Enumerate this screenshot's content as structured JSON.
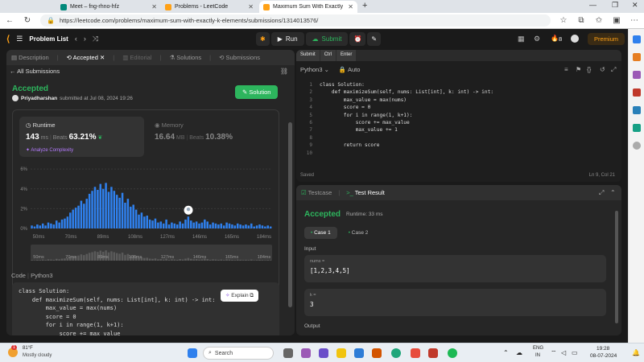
{
  "browser": {
    "tabs": [
      {
        "title": "Meet – fng-rhno-hfz",
        "color": "#00897b",
        "active": false
      },
      {
        "title": "Problems - LeetCode",
        "color": "#ffa116",
        "active": false
      },
      {
        "title": "Maximum Sum With Exactly K Elements",
        "color": "#ffa116",
        "active": true
      }
    ],
    "url": "https://leetcode.com/problems/maximum-sum-with-exactly-k-elements/submissions/1314013576/"
  },
  "nav": {
    "problem_list": "Problem List",
    "run": "Run",
    "submit": "Submit",
    "streak": "8",
    "premium": "Premium"
  },
  "left": {
    "tabs": [
      "Description",
      "Accepted",
      "Editorial",
      "Solutions",
      "Submissions"
    ],
    "all_submissions": "All Submissions",
    "status": "Accepted",
    "author": "Priyadharshan",
    "submitted": "submitted at Jul 08, 2024 19:26",
    "solution_btn": "Solution",
    "runtime": {
      "label": "Runtime",
      "value": "143",
      "unit": "ms",
      "beats_label": "Beats",
      "beats": "63.21%"
    },
    "memory": {
      "label": "Memory",
      "value": "16.64",
      "unit": "MB",
      "beats_label": "Beats",
      "beats": "10.38%"
    },
    "analyze": "Analyze Complexity",
    "code_label": "Code",
    "code_lang": "Python3",
    "explain": "Explain",
    "code_lines": [
      "class Solution:",
      "    def maximizeSum(self, nums: List[int], k: int) -> int:",
      "        max_value = max(nums)",
      "        score = 0",
      "        for i in range(1, k+1):",
      "            score += max_value"
    ]
  },
  "chart_data": {
    "type": "bar",
    "ylabels": [
      "6%",
      "4%",
      "2%",
      "0%"
    ],
    "ylim": [
      0,
      6.5
    ],
    "xlabels": [
      "50ms",
      "70ms",
      "89ms",
      "108ms",
      "127ms",
      "146ms",
      "165ms",
      "184ms"
    ],
    "values": [
      0.3,
      0.2,
      0.4,
      0.3,
      0.5,
      0.3,
      0.6,
      0.5,
      0.4,
      0.8,
      0.6,
      0.9,
      1.0,
      1.2,
      1.6,
      1.9,
      2.1,
      2.3,
      2.8,
      2.5,
      3.0,
      3.5,
      3.8,
      4.2,
      3.9,
      4.5,
      4.0,
      4.6,
      3.7,
      4.2,
      3.8,
      3.4,
      3.1,
      3.6,
      2.6,
      3.0,
      2.2,
      2.4,
      1.9,
      1.4,
      1.6,
      1.2,
      1.3,
      0.9,
      0.8,
      1.0,
      0.6,
      0.7,
      0.5,
      0.9,
      0.4,
      0.6,
      0.5,
      0.4,
      0.7,
      0.5,
      0.9,
      1.2,
      0.8,
      0.6,
      0.7,
      0.5,
      0.6,
      0.9,
      0.7,
      0.4,
      0.6,
      0.5,
      0.4,
      0.5,
      0.3,
      0.6,
      0.5,
      0.4,
      0.3,
      0.5,
      0.4,
      0.3,
      0.4,
      0.3,
      0.5,
      0.2,
      0.3,
      0.4,
      0.3,
      0.2,
      0.3,
      0.2
    ],
    "highlight_index": 57,
    "color": "#2f80ed"
  },
  "editor": {
    "toolbar": [
      "Submit",
      "Ctrl",
      "Enter"
    ],
    "lang": "Python3",
    "auto": "Auto",
    "lines": [
      "class Solution:",
      "    def maximizeSum(self, nums: List[int], k: int) -> int:",
      "        max_value = max(nums)",
      "        score = 0",
      "        for i in range(1, k+1):",
      "            score += max_value",
      "            max_value += 1",
      "",
      "        return score",
      ""
    ],
    "line_numbers": [
      "1",
      "2",
      "3",
      "4",
      "5",
      "6",
      "7",
      "8",
      "9",
      "10"
    ],
    "saved": "Saved",
    "position": "Ln 9, Col 21"
  },
  "test": {
    "tab_testcase": "Testcase",
    "tab_result": "Test Result",
    "status": "Accepted",
    "runtime": "Runtime: 33 ms",
    "cases": [
      "Case 1",
      "Case 2"
    ],
    "input_label": "Input",
    "nums_name": "nums =",
    "nums_value": "[1,2,3,4,5]",
    "k_name": "k =",
    "k_value": "3",
    "output_label": "Output"
  },
  "taskbar": {
    "temp": "81°F",
    "weather": "Mostly cloudy",
    "search": "Search",
    "lang": "ENG",
    "region": "IN",
    "time": "19:28",
    "date": "08-07-2024",
    "badge": "1"
  }
}
